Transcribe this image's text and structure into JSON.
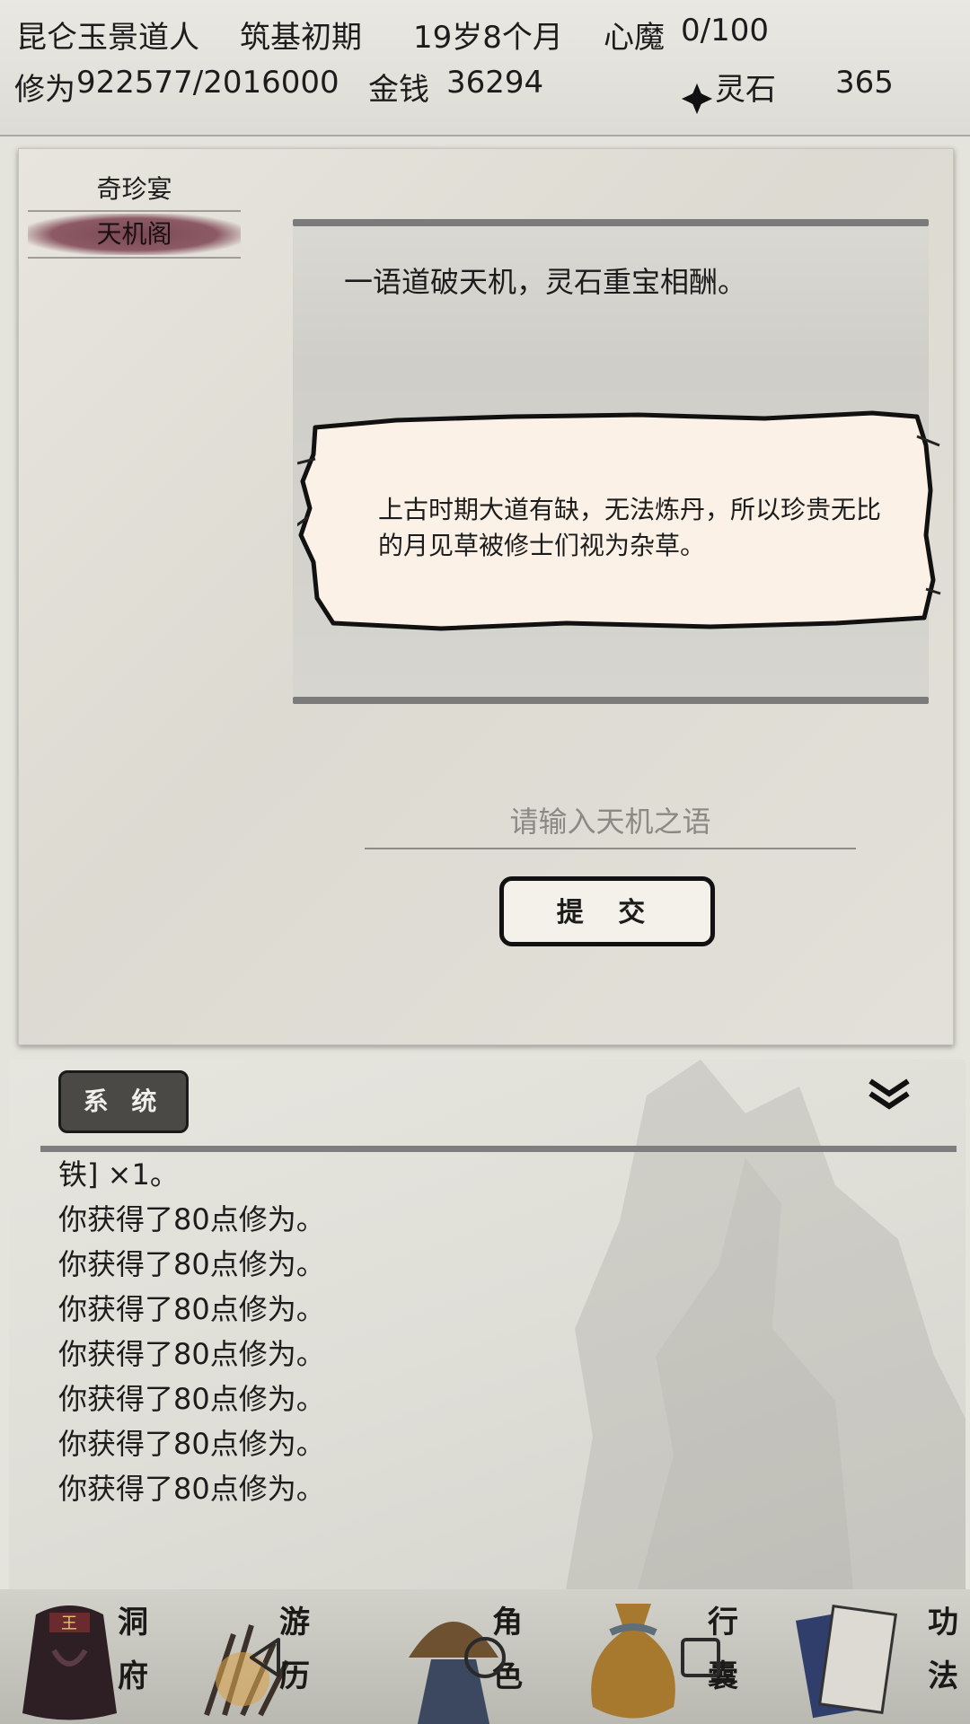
{
  "status": {
    "location": "昆仑",
    "name": "玉景道人",
    "realm": "筑基初期",
    "age": "19岁8个月",
    "demon_label": "心魔",
    "demon_value": "0/100",
    "cultivation_label": "修为",
    "cultivation_value": "922577/2016000",
    "money_label": "金钱",
    "money_value": "36294",
    "stone_label": "灵石",
    "stone_value": "365"
  },
  "tabs": [
    {
      "label": "奇珍宴",
      "active": false
    },
    {
      "label": "天机阁",
      "active": true
    }
  ],
  "riddle_title": "一语道破天机，灵石重宝相酬。",
  "hint_text": "上古时期大道有缺，无法炼丹，所以珍贵无比的月见草被修士们视为杂草。",
  "input": {
    "placeholder": "请输入天机之语",
    "value": ""
  },
  "submit_label": "提 交",
  "log": {
    "tab_label": "系 统",
    "partial_line": "铁] ×1。",
    "lines": [
      "你获得了80点修为。",
      "你获得了80点修为。",
      "你获得了80点修为。",
      "你获得了80点修为。",
      "你获得了80点修为。",
      "你获得了80点修为。",
      "你获得了80点修为。"
    ]
  },
  "nav": [
    {
      "label_top": "洞",
      "label_bottom": "府"
    },
    {
      "label_top": "游",
      "label_bottom": "历"
    },
    {
      "label_top": "角",
      "label_bottom": "色"
    },
    {
      "label_top": "行",
      "label_bottom": "囊"
    },
    {
      "label_top": "功",
      "label_bottom": "法"
    }
  ],
  "colors": {
    "accent_tab": "#8c5a64",
    "nav_bg": "#2b2a27",
    "panel_bg": "#e2e0d8"
  }
}
